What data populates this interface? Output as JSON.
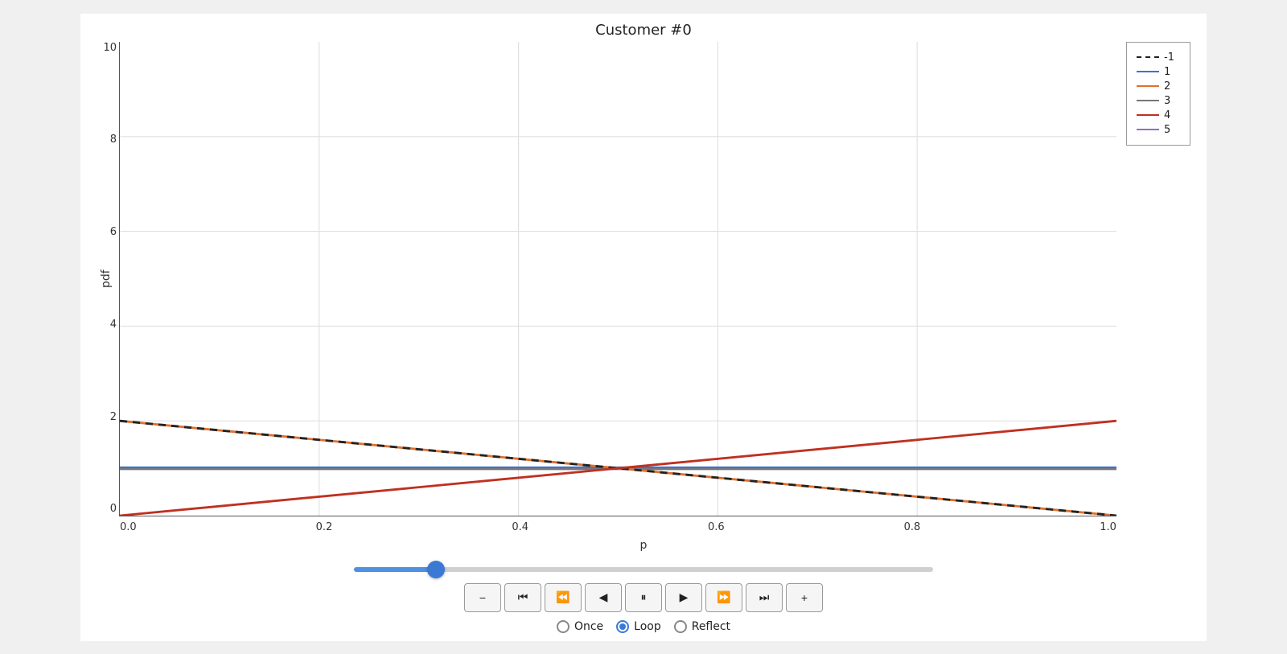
{
  "title": "Customer #0",
  "chart": {
    "x_label": "p",
    "y_label": "pdf",
    "x_ticks": [
      "0.0",
      "0.2",
      "0.4",
      "0.6",
      "0.8",
      "1.0"
    ],
    "y_ticks": [
      "10",
      "8",
      "6",
      "4",
      "2",
      "0"
    ],
    "y_min": 0,
    "y_max": 10,
    "x_min": 0,
    "x_max": 1
  },
  "legend": {
    "items": [
      {
        "label": "-1",
        "style": "dashed"
      },
      {
        "label": "1",
        "style": "solid-blue"
      },
      {
        "label": "2",
        "style": "solid-orange"
      },
      {
        "label": "3",
        "style": "solid-gray"
      },
      {
        "label": "4",
        "style": "solid-red"
      },
      {
        "label": "5",
        "style": "solid-purple"
      }
    ]
  },
  "controls": {
    "slider_value": 13,
    "buttons": [
      {
        "icon": "−",
        "name": "minus-button"
      },
      {
        "icon": "⏮",
        "name": "skip-to-start-button"
      },
      {
        "icon": "⏪",
        "name": "step-back-button"
      },
      {
        "icon": "◀",
        "name": "reverse-button"
      },
      {
        "icon": "⏸",
        "name": "pause-button"
      },
      {
        "icon": "▶",
        "name": "play-button"
      },
      {
        "icon": "⏩",
        "name": "step-forward-button"
      },
      {
        "icon": "⏭",
        "name": "skip-to-end-button"
      },
      {
        "icon": "+",
        "name": "plus-button"
      }
    ],
    "loop_options": [
      {
        "label": "Once",
        "selected": false,
        "name": "once-option"
      },
      {
        "label": "Loop",
        "selected": true,
        "name": "loop-option"
      },
      {
        "label": "Reflect",
        "selected": false,
        "name": "reflect-option"
      }
    ]
  }
}
